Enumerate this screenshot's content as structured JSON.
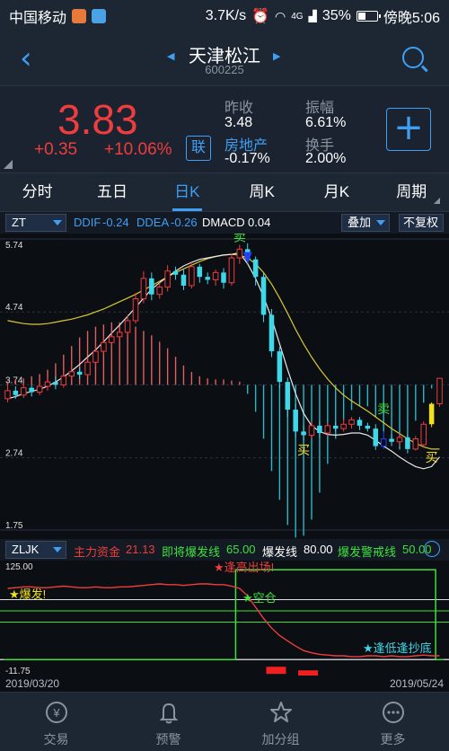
{
  "status": {
    "carrier": "中国移动",
    "speed": "3.7K/s",
    "network": "4G",
    "battery": "35%",
    "time": "傍晚5:06"
  },
  "header": {
    "title": "天津松江",
    "code": "600225"
  },
  "quote": {
    "price": "3.83",
    "change": "+0.35",
    "change_pct": "+10.06%",
    "lian_label": "联",
    "prev_close_label": "昨收",
    "prev_close": "3.48",
    "amplitude_label": "振幅",
    "amplitude": "6.61%",
    "sector_label": "房地产",
    "sector_change": "-0.17%",
    "turnover_label": "换手",
    "turnover": "2.00%"
  },
  "tabs": [
    {
      "label": "分时"
    },
    {
      "label": "五日"
    },
    {
      "label": "日K"
    },
    {
      "label": "周K"
    },
    {
      "label": "月K"
    },
    {
      "label": "周期"
    }
  ],
  "main_strip": {
    "selector": "ZT",
    "ddif_label": "DDIF",
    "ddif": "-0.24",
    "ddea_label": "DDEA",
    "ddea": "-0.26",
    "dmacd_label": "DMACD",
    "dmacd": "0.04",
    "overlay_button": "叠加",
    "adjust_button": "不复权"
  },
  "ind_strip": {
    "selector": "ZLJK",
    "main_fund_label": "主力资金",
    "main_fund": "21.13",
    "near_label": "即将爆发线",
    "near": "65.00",
    "burst_label": "爆发线",
    "burst": "80.00",
    "warn_label": "爆发警戒线",
    "warn": "50.00"
  },
  "dates": {
    "start": "2019/03/20",
    "end": "2019/05/24"
  },
  "bottom_nav": [
    {
      "label": "交易",
      "icon": "trade-icon"
    },
    {
      "label": "预警",
      "icon": "bell-icon"
    },
    {
      "label": "加分组",
      "icon": "star-icon"
    },
    {
      "label": "更多",
      "icon": "more-icon"
    }
  ],
  "colors": {
    "up": "#ee3d3d",
    "down": "#3fd8e8",
    "accent": "#3f9ff5",
    "ma_white": "#e8e8e8",
    "ma_yellow": "#d8c830",
    "signal_green": "#3ee03e",
    "signal_yellow": "#f0e020"
  },
  "chart_data": [
    {
      "type": "candlestick",
      "title": "",
      "y_ticks": [
        "5.74",
        "4.74",
        "3.74",
        "2.74",
        "1.75"
      ],
      "ylim": [
        1.75,
        5.74
      ],
      "candles": [
        [
          3.55,
          3.66,
          3.5,
          3.75
        ],
        [
          3.66,
          3.6,
          3.55,
          3.72
        ],
        [
          3.6,
          3.7,
          3.56,
          3.76
        ],
        [
          3.7,
          3.64,
          3.58,
          3.74
        ],
        [
          3.64,
          3.72,
          3.6,
          3.78
        ],
        [
          3.72,
          3.78,
          3.66,
          3.84
        ],
        [
          3.78,
          3.74,
          3.68,
          3.86
        ],
        [
          3.74,
          3.86,
          3.7,
          3.92
        ],
        [
          3.86,
          3.92,
          3.8,
          4.0
        ],
        [
          3.92,
          3.88,
          3.82,
          3.98
        ],
        [
          3.88,
          4.05,
          3.86,
          4.12
        ],
        [
          4.05,
          4.2,
          4.0,
          4.28
        ],
        [
          4.2,
          4.32,
          4.16,
          4.4
        ],
        [
          4.32,
          4.4,
          4.25,
          4.48
        ],
        [
          4.4,
          4.46,
          4.34,
          4.55
        ],
        [
          4.46,
          4.62,
          4.4,
          4.7
        ],
        [
          4.62,
          4.92,
          4.58,
          5.0
        ],
        [
          4.92,
          5.2,
          4.86,
          5.3
        ],
        [
          5.2,
          4.98,
          4.9,
          5.28
        ],
        [
          4.98,
          5.08,
          4.92,
          5.14
        ],
        [
          5.08,
          5.3,
          5.02,
          5.38
        ],
        [
          5.3,
          5.25,
          5.18,
          5.36
        ],
        [
          5.25,
          5.1,
          5.04,
          5.32
        ],
        [
          5.1,
          5.36,
          5.06,
          5.42
        ],
        [
          5.36,
          5.22,
          5.14,
          5.4
        ],
        [
          5.22,
          5.18,
          5.12,
          5.28
        ],
        [
          5.18,
          5.28,
          5.1,
          5.32
        ],
        [
          5.28,
          5.14,
          5.06,
          5.34
        ],
        [
          5.14,
          5.48,
          5.1,
          5.54
        ],
        [
          5.48,
          5.6,
          5.4,
          5.66
        ],
        [
          5.6,
          5.46,
          5.4,
          5.68
        ],
        [
          5.46,
          5.22,
          5.1,
          5.5
        ],
        [
          5.22,
          4.7,
          4.6,
          5.28
        ],
        [
          4.7,
          4.2,
          4.12,
          4.78
        ],
        [
          4.2,
          3.78,
          3.7,
          4.26
        ],
        [
          3.78,
          3.4,
          3.3,
          3.84
        ],
        [
          3.4,
          3.1,
          3.02,
          3.48
        ],
        [
          3.1,
          3.05,
          2.98,
          3.18
        ],
        [
          3.05,
          3.18,
          3.0,
          3.24
        ],
        [
          3.18,
          3.08,
          3.02,
          3.24
        ],
        [
          3.08,
          3.18,
          3.04,
          3.22
        ],
        [
          3.18,
          3.14,
          3.1,
          3.24
        ],
        [
          3.14,
          3.2,
          3.1,
          3.28
        ],
        [
          3.2,
          3.26,
          3.14,
          3.3
        ],
        [
          3.26,
          3.18,
          3.12,
          3.3
        ],
        [
          3.18,
          3.14,
          3.1,
          3.22
        ],
        [
          3.14,
          2.9,
          2.85,
          3.2
        ],
        [
          2.9,
          3.0,
          2.86,
          3.1
        ],
        [
          3.0,
          2.96,
          2.9,
          3.06
        ],
        [
          2.96,
          3.02,
          2.9,
          3.08
        ],
        [
          3.02,
          2.86,
          2.8,
          3.06
        ],
        [
          2.86,
          3.0,
          2.84,
          3.04
        ],
        [
          2.92,
          3.2,
          2.88,
          3.24
        ],
        [
          3.2,
          3.48,
          3.16,
          3.5
        ],
        [
          3.48,
          3.83,
          3.44,
          3.83
        ]
      ],
      "ma_white": [
        3.55,
        3.58,
        3.62,
        3.65,
        3.68,
        3.72,
        3.78,
        3.85,
        3.93,
        4.02,
        4.12,
        4.22,
        4.33,
        4.45,
        4.56,
        4.68,
        4.8,
        4.93,
        5.05,
        5.14,
        5.22,
        5.3,
        5.37,
        5.42,
        5.46,
        5.48,
        5.5,
        5.52,
        5.53,
        5.55,
        5.4,
        5.2,
        4.95,
        4.65,
        4.3,
        3.95,
        3.62,
        3.35,
        3.18,
        3.1,
        3.06,
        3.05,
        3.06,
        3.08,
        3.08,
        3.05,
        2.98,
        2.9,
        2.83,
        2.75,
        2.68,
        2.62,
        2.59,
        2.62,
        2.75
      ],
      "ma_yellow": [
        4.62,
        4.6,
        4.58,
        4.57,
        4.57,
        4.58,
        4.6,
        4.62,
        4.64,
        4.67,
        4.7,
        4.74,
        4.78,
        4.83,
        4.88,
        4.93,
        4.98,
        5.04,
        5.1,
        5.16,
        5.22,
        5.28,
        5.33,
        5.38,
        5.43,
        5.47,
        5.5,
        5.52,
        5.53,
        5.52,
        5.48,
        5.4,
        5.28,
        5.12,
        4.93,
        4.72,
        4.5,
        4.3,
        4.12,
        3.96,
        3.82,
        3.7,
        3.6,
        3.52,
        3.45,
        3.38,
        3.3,
        3.22,
        3.14,
        3.07,
        3.0,
        2.94,
        2.89,
        2.86,
        2.86
      ],
      "macd": [
        0.03,
        0.05,
        0.06,
        0.08,
        0.1,
        0.14,
        0.2,
        0.28,
        0.36,
        0.44,
        0.5,
        0.54,
        0.56,
        0.58,
        0.58,
        0.56,
        0.54,
        0.5,
        0.46,
        0.4,
        0.34,
        0.26,
        0.18,
        0.12,
        0.08,
        0.06,
        0.05,
        0.05,
        0.04,
        0.03,
        -0.05,
        -0.15,
        -0.3,
        -0.48,
        -0.64,
        -0.78,
        -0.85,
        -0.84,
        -0.75,
        -0.6,
        -0.44,
        -0.3,
        -0.2,
        -0.14,
        -0.12,
        -0.12,
        -0.18,
        -0.26,
        -0.32,
        -0.36,
        -0.3,
        -0.2,
        -0.1,
        -0.02,
        0.04
      ],
      "labels": {
        "sell1": "卖",
        "buy1": "买",
        "sell2": "卖",
        "buy2": "买"
      }
    },
    {
      "type": "line",
      "y_ticks": [
        "125.00",
        "-11.75"
      ],
      "ylim": [
        -11.75,
        125
      ],
      "levels": [
        80,
        65,
        50
      ],
      "main_fund": [
        95,
        96,
        97,
        97,
        96,
        96,
        97,
        98,
        97,
        96,
        96,
        97,
        96,
        96,
        97,
        97,
        98,
        99,
        100,
        101,
        100,
        100,
        99,
        100,
        101,
        101,
        100,
        100,
        98,
        95,
        85,
        70,
        55,
        42,
        32,
        25,
        18,
        12,
        9,
        7,
        6,
        5,
        5,
        4,
        4,
        5,
        5,
        4,
        5,
        4,
        4,
        5,
        6,
        5,
        5
      ],
      "step": [
        0,
        0,
        0,
        0,
        0,
        0,
        0,
        0,
        0,
        0,
        0,
        0,
        0,
        0,
        0,
        0,
        0,
        0,
        0,
        0,
        0,
        0,
        0,
        0,
        0,
        0,
        0,
        0,
        0,
        120,
        120,
        120,
        120,
        120,
        120,
        120,
        120,
        120,
        120,
        120,
        120,
        120,
        120,
        120,
        120,
        120,
        120,
        120,
        120,
        120,
        120,
        120,
        120,
        120,
        0
      ],
      "annotations": {
        "burst": "★爆发!",
        "peak": "★逢高出场!",
        "empty": "★空仓",
        "bottom": "★逢低逢抄底"
      }
    }
  ]
}
